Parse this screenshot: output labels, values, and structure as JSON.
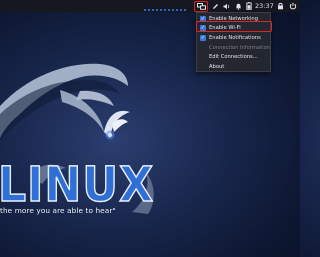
{
  "topbar": {
    "clock": "23:37",
    "tray_icons": [
      "network-icon",
      "pen-icon",
      "speaker-icon",
      "bell-icon",
      "lock-icon",
      "power-icon"
    ]
  },
  "network_menu": {
    "items": [
      {
        "label": "Enable Networking",
        "checked": true,
        "enabled": true
      },
      {
        "label": "Enable Wi-Fi",
        "checked": true,
        "enabled": true,
        "highlighted": true
      },
      {
        "label": "Enable Notifications",
        "checked": true,
        "enabled": true
      },
      {
        "label": "Connection Information",
        "checked": false,
        "enabled": false
      },
      {
        "label": "Edit Connections...",
        "checked": false,
        "enabled": true
      },
      {
        "label": "About",
        "checked": false,
        "enabled": true
      }
    ]
  },
  "wallpaper": {
    "brand_word": "LINUX",
    "tagline": "the more you are able to hear\""
  },
  "colors": {
    "accent": "#2f6fd6",
    "highlight": "#e0251b",
    "background": "#17254a"
  }
}
